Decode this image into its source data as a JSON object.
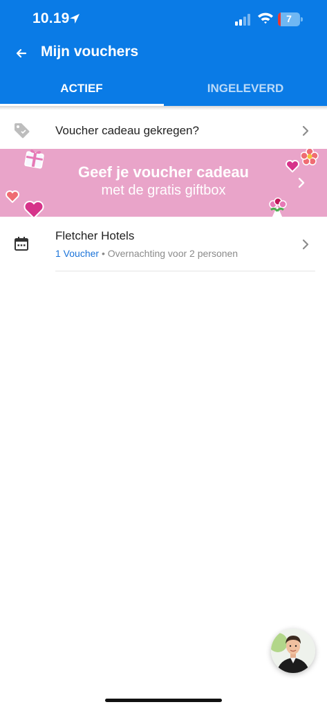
{
  "status_bar": {
    "time": "10.19",
    "battery_level": "7"
  },
  "header": {
    "title": "Mijn vouchers"
  },
  "tabs": [
    {
      "label": "ACTIEF",
      "active": true
    },
    {
      "label": "INGELEVERD",
      "active": false
    }
  ],
  "gift_row": {
    "label": "Voucher cadeau gekregen?"
  },
  "banner": {
    "line1": "Geef je voucher cadeau",
    "line2": "met de gratis giftbox"
  },
  "vouchers": [
    {
      "name": "Fletcher Hotels",
      "count": "1 Voucher",
      "separator": "•",
      "description": "Overnachting voor 2 personen"
    }
  ],
  "colors": {
    "header": "#0a7be6",
    "banner": "#e9a4c9",
    "link_blue": "#1a73d9"
  }
}
